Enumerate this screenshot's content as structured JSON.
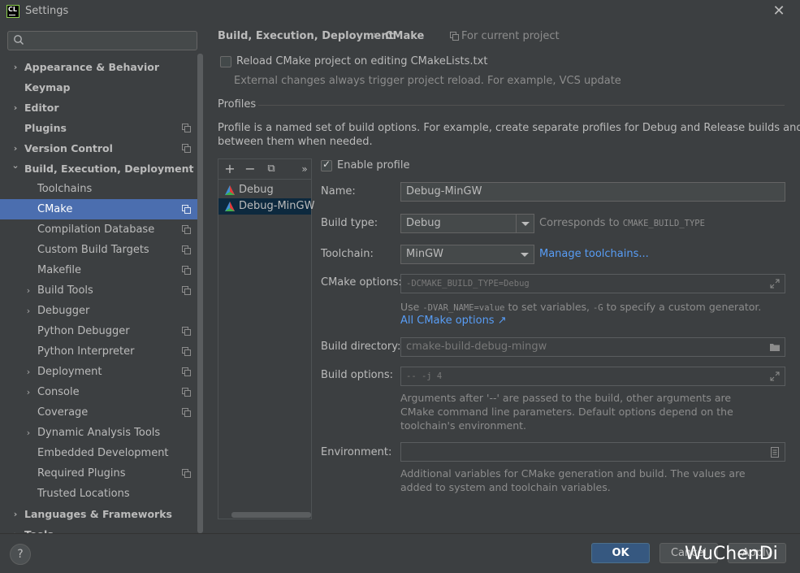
{
  "window": {
    "title": "Settings",
    "logo_text": "CL"
  },
  "search": {
    "placeholder": ""
  },
  "sidebar": {
    "items": [
      {
        "label": "Appearance & Behavior",
        "level": 0,
        "arrow": "›",
        "bold": true,
        "proj": false
      },
      {
        "label": "Keymap",
        "level": 0,
        "arrow": "",
        "bold": true,
        "proj": false
      },
      {
        "label": "Editor",
        "level": 0,
        "arrow": "›",
        "bold": true,
        "proj": false
      },
      {
        "label": "Plugins",
        "level": 0,
        "arrow": "",
        "bold": true,
        "proj": true
      },
      {
        "label": "Version Control",
        "level": 0,
        "arrow": "›",
        "bold": true,
        "proj": true
      },
      {
        "label": "Build, Execution, Deployment",
        "level": 0,
        "arrow": "⌄",
        "bold": true,
        "proj": false
      },
      {
        "label": "Toolchains",
        "level": 1,
        "arrow": "",
        "bold": false,
        "proj": false
      },
      {
        "label": "CMake",
        "level": 1,
        "arrow": "",
        "bold": false,
        "proj": true,
        "selected": true
      },
      {
        "label": "Compilation Database",
        "level": 1,
        "arrow": "",
        "bold": false,
        "proj": true
      },
      {
        "label": "Custom Build Targets",
        "level": 1,
        "arrow": "",
        "bold": false,
        "proj": true
      },
      {
        "label": "Makefile",
        "level": 1,
        "arrow": "",
        "bold": false,
        "proj": true
      },
      {
        "label": "Build Tools",
        "level": 1,
        "arrow": "›",
        "bold": false,
        "proj": true
      },
      {
        "label": "Debugger",
        "level": 1,
        "arrow": "›",
        "bold": false,
        "proj": false
      },
      {
        "label": "Python Debugger",
        "level": 1,
        "arrow": "",
        "bold": false,
        "proj": true
      },
      {
        "label": "Python Interpreter",
        "level": 1,
        "arrow": "",
        "bold": false,
        "proj": true
      },
      {
        "label": "Deployment",
        "level": 1,
        "arrow": "›",
        "bold": false,
        "proj": true
      },
      {
        "label": "Console",
        "level": 1,
        "arrow": "›",
        "bold": false,
        "proj": true
      },
      {
        "label": "Coverage",
        "level": 1,
        "arrow": "",
        "bold": false,
        "proj": true
      },
      {
        "label": "Dynamic Analysis Tools",
        "level": 1,
        "arrow": "›",
        "bold": false,
        "proj": false
      },
      {
        "label": "Embedded Development",
        "level": 1,
        "arrow": "",
        "bold": false,
        "proj": false
      },
      {
        "label": "Required Plugins",
        "level": 1,
        "arrow": "",
        "bold": false,
        "proj": true
      },
      {
        "label": "Trusted Locations",
        "level": 1,
        "arrow": "",
        "bold": false,
        "proj": false
      },
      {
        "label": "Languages & Frameworks",
        "level": 0,
        "arrow": "›",
        "bold": true,
        "proj": false
      },
      {
        "label": "Tools",
        "level": 0,
        "arrow": "›",
        "bold": true,
        "proj": false
      }
    ]
  },
  "breadcrumb": {
    "parent": "Build, Execution, Deployment",
    "sep": "›",
    "current": "CMake",
    "scope": "For current project"
  },
  "reload": {
    "label": "Reload CMake project on editing CMakeLists.txt",
    "checked": false,
    "hint": "External changes always trigger project reload. For example, VCS update"
  },
  "profiles": {
    "section": "Profiles",
    "description_line1": "Profile is a named set of build options. For example, create separate profiles for Debug and Release builds and switch",
    "description_line2": "between them when needed.",
    "toolbar": {
      "add": "+",
      "remove": "−",
      "copy": "⧉",
      "more": "»"
    },
    "list": [
      {
        "name": "Debug",
        "selected": false
      },
      {
        "name": "Debug-MinGW",
        "selected": true
      }
    ]
  },
  "form": {
    "enable_profile": {
      "label": "Enable profile",
      "checked": true
    },
    "name": {
      "label": "Name:",
      "value": "Debug-MinGW"
    },
    "build_type": {
      "label": "Build type:",
      "value": "Debug",
      "hint": "Corresponds to",
      "hint_code": "CMAKE_BUILD_TYPE"
    },
    "toolchain": {
      "label": "Toolchain:",
      "value": "MinGW",
      "link": "Manage toolchains..."
    },
    "cmake_options": {
      "label": "CMake options:",
      "value": "-DCMAKE_BUILD_TYPE=Debug",
      "help_prefix": "Use",
      "help_code1": "-DVAR_NAME=value",
      "help_mid": "to set variables,",
      "help_code2": "-G",
      "help_suffix": "to specify a custom generator.",
      "link": "All CMake options ↗"
    },
    "build_directory": {
      "label": "Build directory:",
      "value": "cmake-build-debug-mingw"
    },
    "build_options": {
      "label": "Build options:",
      "value": "-- -j 4",
      "help1": "Arguments after '--' are passed to the build, other arguments are",
      "help2": "CMake command line parameters. Default options depend on the",
      "help3": "toolchain's environment."
    },
    "environment": {
      "label": "Environment:",
      "value": "",
      "help1": "Additional variables for CMake generation and build. The values are",
      "help2": "added to system and toolchain variables."
    }
  },
  "footer": {
    "help": "?",
    "ok": "OK",
    "cancel": "Cancel",
    "apply": "Apply"
  },
  "watermark": "WuChenDi",
  "colors": {
    "accent": "#4b6eaf",
    "ok_button": "#365880",
    "link": "#589df6",
    "background": "#3c3f41"
  }
}
